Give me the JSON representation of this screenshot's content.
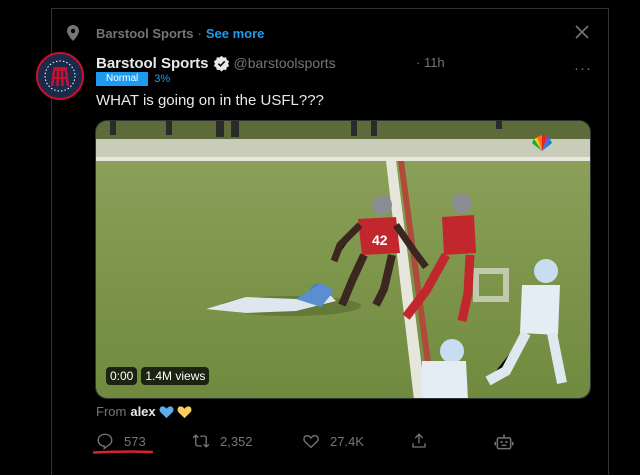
{
  "context": {
    "source": "Barstool Sports",
    "separator": "·",
    "see_more": "See more"
  },
  "tweet": {
    "display_name": "Barstool Sports",
    "handle": "@barstoolsports",
    "time": "· 11h",
    "more": "···",
    "tag_label": "Normal",
    "tag_percent": "3%",
    "text": "WHAT is going on in the USFL???"
  },
  "video": {
    "time": "0:00",
    "views": "1.4M views",
    "jersey_number": "42"
  },
  "attribution": {
    "prefix": "From",
    "user": "alex"
  },
  "actions": {
    "replies": "573",
    "retweets": "2,352",
    "likes": "27.4K"
  },
  "colors": {
    "accent": "#1d9bf0",
    "muted": "#71767b",
    "underline": "#e0212e"
  },
  "icons": [
    "location-pin-icon",
    "close-icon",
    "verified-badge-icon",
    "reply-icon",
    "retweet-icon",
    "like-icon",
    "share-icon",
    "bot-icon",
    "blue-heart-icon",
    "yellow-heart-icon"
  ]
}
